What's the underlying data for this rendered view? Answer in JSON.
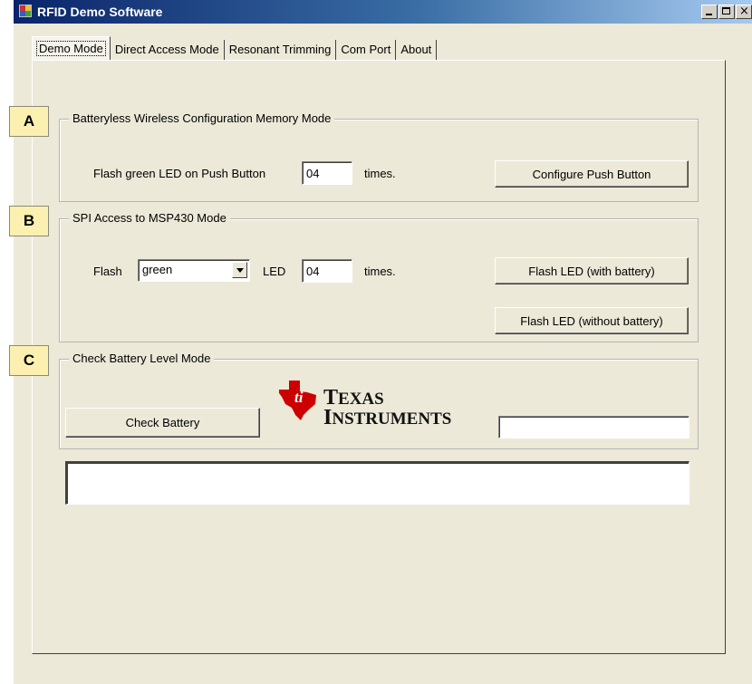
{
  "window": {
    "title": "RFID Demo Software"
  },
  "tabs": [
    {
      "label": "Demo Mode"
    },
    {
      "label": "Direct Access Mode"
    },
    {
      "label": "Resonant Trimming"
    },
    {
      "label": "Com Port"
    },
    {
      "label": "About"
    }
  ],
  "markers": [
    "A",
    "B",
    "C"
  ],
  "group_a": {
    "title": "Batteryless Wireless  Configuration Memory Mode",
    "flash_label": "Flash green LED on Push Button",
    "count_value": "04",
    "times_label": "times.",
    "configure_button": "Configure Push Button"
  },
  "group_b": {
    "title": "SPI Access to MSP430 Mode",
    "flash_label": "Flash",
    "color_value": "green",
    "led_label": "LED",
    "count_value": "04",
    "times_label": "times.",
    "flash_with_battery_button": "Flash LED (with battery)",
    "flash_without_battery_button": "Flash LED (without battery)"
  },
  "group_c": {
    "title": "Check Battery Level Mode",
    "check_battery_button": "Check Battery",
    "battery_result_value": ""
  },
  "logo": {
    "line1_cap": "T",
    "line1_rest": "EXAS",
    "line2_cap": "I",
    "line2_rest": "NSTRUMENTS",
    "red": "#cc0000"
  },
  "output": {
    "value": ""
  }
}
